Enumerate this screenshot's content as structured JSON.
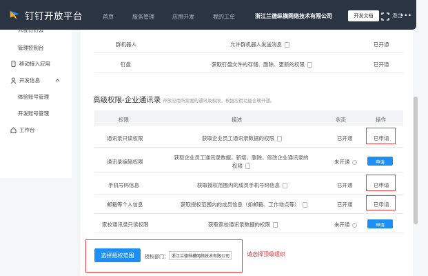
{
  "topbar": {
    "brand": "钉钉开放平台",
    "nav": [
      "首页",
      "服务管理",
      "应用开发",
      "我的工单"
    ],
    "company": "浙江兰德纵横网络技术有限公司",
    "doc_button": "开发文档",
    "exit": "退出",
    "more": "..."
  },
  "sidebar": {
    "items": [
      {
        "label": "入驻钉钉云"
      },
      {
        "label": "管理控制台"
      },
      {
        "label": "移动接入应用"
      },
      {
        "label": "开发信息"
      },
      {
        "label": "体验账号管理"
      },
      {
        "label": "开发账号管理"
      },
      {
        "label": "工作台"
      }
    ]
  },
  "upper_rows": [
    {
      "name": "群机器人",
      "desc": "允许群机器人发送消息",
      "status": "已开通"
    },
    {
      "name": "钉盘",
      "desc": "获取钉盘文件的存储、删除、更新的权限",
      "status": "已开通"
    }
  ],
  "section": {
    "title": "高级权限-企业通讯录",
    "subtitle": "开放应用所需要的通讯录权限，根据应用功能合理开通。"
  },
  "table": {
    "headers": [
      "权限",
      "描述",
      "状态",
      "操作"
    ],
    "rows": [
      {
        "name": "通讯录只读权限",
        "desc": "获取企业员工通讯录数据的权限",
        "desc2": "",
        "status": "已开通",
        "action": "已申请",
        "action_type": "text"
      },
      {
        "name": "通讯录编辑权限",
        "desc": "获取企业员工通讯录数据，新增、删除、修改企业通讯录的权限",
        "desc2": "",
        "status": "未开通",
        "action": "申请",
        "action_type": "button"
      },
      {
        "name": "手机号码信息",
        "desc": "获取授权范围内的成员手机号码信息",
        "desc2": "",
        "status": "已开通",
        "action": "已申请",
        "action_type": "text"
      },
      {
        "name": "邮箱等个人信息",
        "desc": "获取授权范围内的成员信息（如邮箱、工作地点等）",
        "desc2": "",
        "status": "已开通",
        "action": "已申请",
        "action_type": "text"
      },
      {
        "name": "家校通讯录只读权限",
        "desc": "获取家校通讯录数据的权限",
        "desc2": "",
        "status": "未开通",
        "action": "申请",
        "action_type": "button"
      }
    ]
  },
  "footer": {
    "choose_button": "选择授权范围",
    "dept_label": "授权部门：",
    "dept_value": "浙江兰德纵横网络技术有限公司",
    "hint": "请选择顶级组织"
  },
  "colors": {
    "accent": "#1d8ff2",
    "highlight": "#e03a3a",
    "topbar": "#2b3443"
  }
}
